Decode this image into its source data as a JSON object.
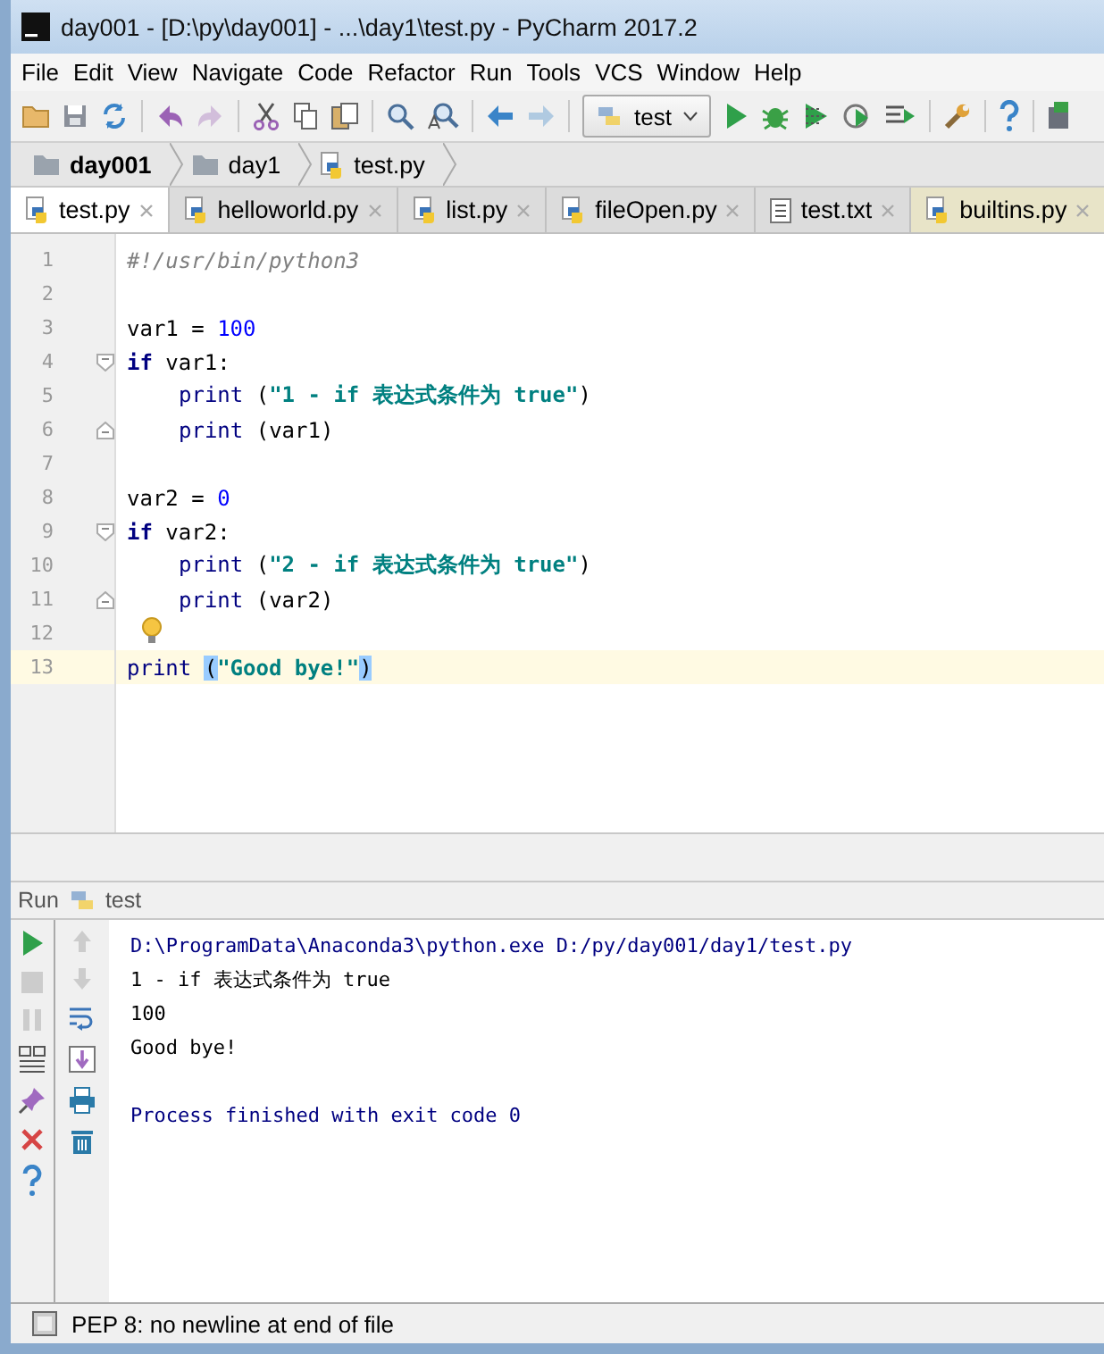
{
  "window": {
    "title": "day001 - [D:\\py\\day001] - ...\\day1\\test.py - PyCharm 2017.2"
  },
  "menu": [
    "File",
    "Edit",
    "View",
    "Navigate",
    "Code",
    "Refactor",
    "Run",
    "Tools",
    "VCS",
    "Window",
    "Help"
  ],
  "toolbar": {
    "buttons_left": [
      {
        "disabled": false
      },
      {
        "disabled": false
      },
      {
        "disabled": false
      },
      {
        "disabled": false
      },
      {
        "disabled": true
      },
      {
        "disabled": false
      },
      {
        "disabled": false
      },
      {
        "disabled": false
      },
      {
        "disabled": false
      },
      {
        "disabled": false
      },
      {
        "disabled": false
      },
      {
        "disabled": true
      }
    ],
    "run_config": "test",
    "buttons_right": [
      {
        "disabled": false
      },
      {
        "disabled": false
      },
      {
        "disabled": false
      },
      {
        "disabled": false
      },
      {
        "disabled": false
      },
      {
        "disabled": false
      },
      {
        "disabled": false
      },
      {
        "disabled": false
      }
    ]
  },
  "breadcrumbs": [
    {
      "label": "day001",
      "kind": "project"
    },
    {
      "label": "day1",
      "kind": "folder"
    },
    {
      "label": "test.py",
      "kind": "python"
    }
  ],
  "tabs": [
    {
      "label": "test.py",
      "kind": "python",
      "selected": true,
      "library": false
    },
    {
      "label": "helloworld.py",
      "kind": "python",
      "selected": false,
      "library": false
    },
    {
      "label": "list.py",
      "kind": "python",
      "selected": false,
      "library": false
    },
    {
      "label": "fileOpen.py",
      "kind": "python",
      "selected": false,
      "library": false
    },
    {
      "label": "test.txt",
      "kind": "text",
      "selected": false,
      "library": false
    },
    {
      "label": "builtins.py",
      "kind": "python",
      "selected": false,
      "library": true
    }
  ],
  "editor": {
    "lines": [
      {
        "number": "1",
        "current": false,
        "fold_start": false,
        "fold_end": false,
        "bulb": false,
        "indented": false,
        "tokens": [
          {
            "kind": "comment",
            "text": "#!/usr/bin/python3"
          }
        ]
      },
      {
        "number": "2",
        "current": false,
        "fold_start": false,
        "fold_end": false,
        "bulb": false
      },
      {
        "number": "3",
        "current": false,
        "fold_start": false,
        "fold_end": false,
        "bulb": false,
        "indented": false,
        "tokens": [
          {
            "kind": "plain",
            "text": "var1 = "
          },
          {
            "kind": "number",
            "text": "100"
          }
        ]
      },
      {
        "number": "4",
        "current": false,
        "fold_start": true,
        "fold_end": false,
        "bulb": false,
        "indented": false,
        "tokens": [
          {
            "kind": "keyword",
            "text": "if"
          },
          {
            "kind": "plain",
            "text": " var1:"
          }
        ]
      },
      {
        "number": "5",
        "current": false,
        "fold_start": false,
        "fold_end": false,
        "bulb": false,
        "indented": true,
        "tokens": [
          {
            "kind": "builtin",
            "text": "print"
          },
          {
            "kind": "plain",
            "text": " ("
          },
          {
            "kind": "string",
            "text": "\"1 - if 表达式条件为 true\""
          },
          {
            "kind": "plain",
            "text": ")"
          }
        ]
      },
      {
        "number": "6",
        "current": false,
        "fold_start": false,
        "fold_end": true,
        "bulb": false,
        "indented": true,
        "tokens": [
          {
            "kind": "builtin",
            "text": "print"
          },
          {
            "kind": "plain",
            "text": " (var1)"
          }
        ]
      },
      {
        "number": "7",
        "current": false,
        "fold_start": false,
        "fold_end": false,
        "bulb": false
      },
      {
        "number": "8",
        "current": false,
        "fold_start": false,
        "fold_end": false,
        "bulb": false,
        "indented": false,
        "tokens": [
          {
            "kind": "plain",
            "text": "var2 = "
          },
          {
            "kind": "number",
            "text": "0"
          }
        ]
      },
      {
        "number": "9",
        "current": false,
        "fold_start": true,
        "fold_end": false,
        "bulb": false,
        "indented": false,
        "tokens": [
          {
            "kind": "keyword",
            "text": "if"
          },
          {
            "kind": "plain",
            "text": " var2:"
          }
        ]
      },
      {
        "number": "10",
        "current": false,
        "fold_start": false,
        "fold_end": false,
        "bulb": false,
        "indented": true,
        "tokens": [
          {
            "kind": "builtin",
            "text": "print"
          },
          {
            "kind": "plain",
            "text": " ("
          },
          {
            "kind": "string",
            "text": "\"2 - if 表达式条件为 true\""
          },
          {
            "kind": "plain",
            "text": ")"
          }
        ]
      },
      {
        "number": "11",
        "current": false,
        "fold_start": false,
        "fold_end": true,
        "bulb": false,
        "indented": true,
        "tokens": [
          {
            "kind": "builtin",
            "text": "print"
          },
          {
            "kind": "plain",
            "text": " (var2)"
          }
        ]
      },
      {
        "number": "12",
        "current": false,
        "fold_start": false,
        "fold_end": false,
        "bulb": true
      },
      {
        "number": "13",
        "current": true,
        "fold_start": false,
        "fold_end": false,
        "bulb": false,
        "indented": false,
        "tokens": [
          {
            "kind": "builtin",
            "text": "print"
          },
          {
            "kind": "brace",
            "text": "(",
            "space_before": true
          },
          {
            "kind": "string",
            "text": "\"Good bye!\""
          },
          {
            "kind": "brace",
            "text": ")"
          }
        ]
      }
    ]
  },
  "run_panel": {
    "title": "Run",
    "config": "test",
    "left_buttons": [
      {
        "disabled": false
      },
      {
        "disabled": true
      },
      {
        "disabled": true
      },
      {
        "disabled": false
      },
      {
        "disabled": false
      },
      {
        "disabled": false
      },
      {
        "disabled": false
      }
    ],
    "second_buttons": [
      {
        "disabled": true
      },
      {
        "disabled": true
      },
      {
        "disabled": false
      },
      {
        "disabled": false
      },
      {
        "disabled": false
      },
      {
        "disabled": false
      }
    ],
    "console": [
      {
        "kind": "system",
        "text": "D:\\ProgramData\\Anaconda3\\python.exe D:/py/day001/day1/test.py"
      },
      {
        "kind": "stdout",
        "text": "1 - if 表达式条件为 true"
      },
      {
        "kind": "stdout",
        "text": "100"
      },
      {
        "kind": "stdout",
        "text": "Good bye!"
      },
      {
        "kind": "blank"
      },
      {
        "kind": "system",
        "text": "Process finished with exit code 0"
      }
    ]
  },
  "status_bar": {
    "message": "PEP 8: no newline at end of file"
  }
}
